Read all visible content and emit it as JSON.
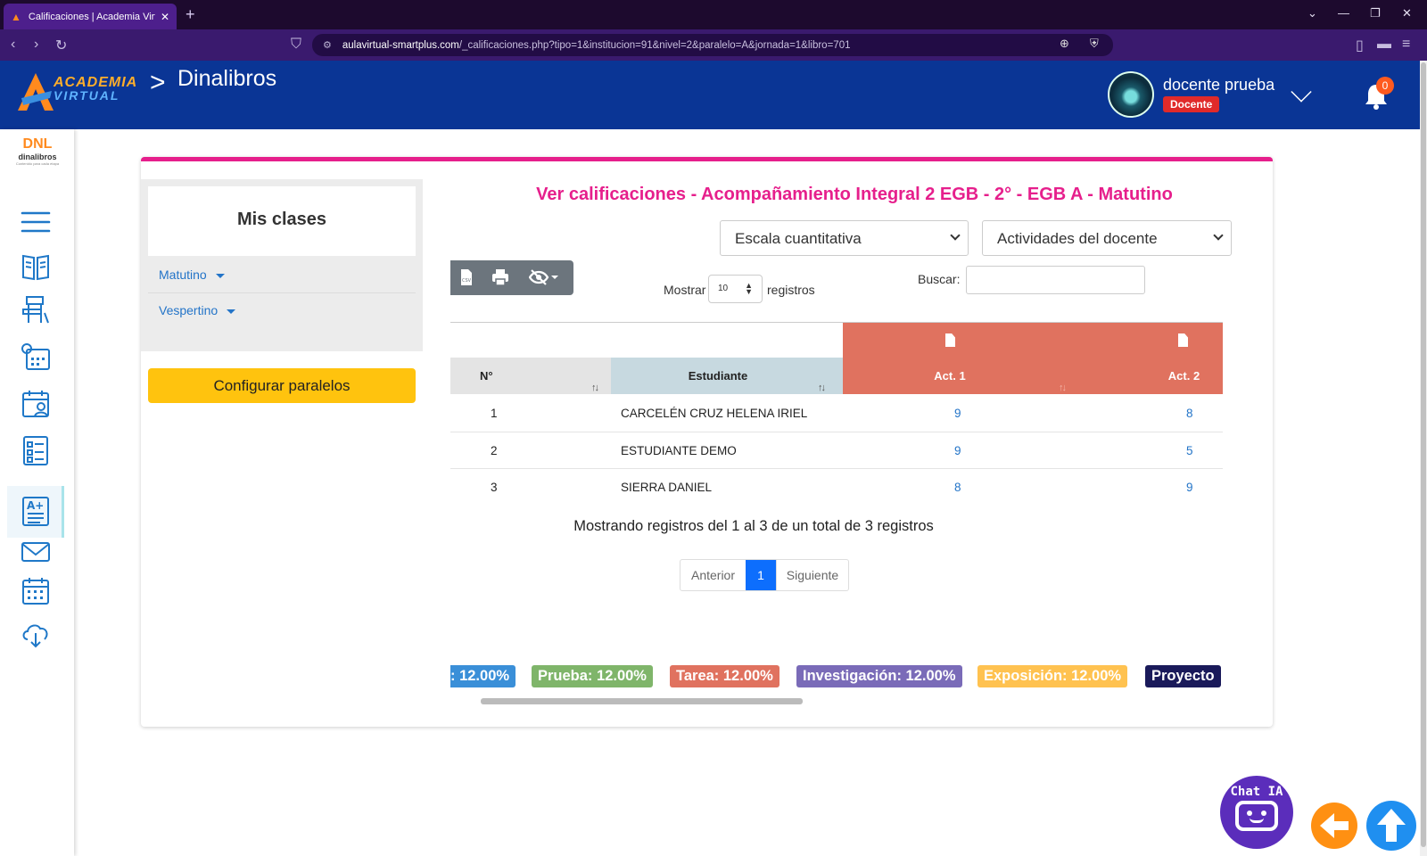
{
  "browser": {
    "tab_title": "Calificaciones | Academia Virtu",
    "url_domain": "aulavirtual-smartplus.com",
    "url_path": "/_calificaciones.php?tipo=1&institucion=91&nivel=2&paralelo=A&jornada=1&libro=701"
  },
  "header": {
    "logo_line1": "ACADEMIA",
    "logo_line2": "VIRTUAL",
    "section_title": "Dinalibros",
    "user_name": "docente prueba",
    "user_role": "Docente",
    "notifications_count": "0"
  },
  "sidebar": {
    "brand_mark": "DNL",
    "brand_name": "dinalibros",
    "brand_tagline": "Contenido para cada etapa",
    "items": [
      "menu",
      "libros",
      "aula",
      "horario",
      "agenda",
      "tareas",
      "calificaciones",
      "mensajes",
      "calendario",
      "descargas"
    ],
    "active_item": "calificaciones"
  },
  "left_panel": {
    "title": "Mis clases",
    "jornadas": [
      "Matutino",
      "Vespertino"
    ],
    "config_button": "Configurar paralelos"
  },
  "main": {
    "title": "Ver calificaciones - Acompañamiento Integral 2 EGB - 2° - EGB A - Matutino",
    "scale_select": "Escala cuantitativa",
    "activities_select": "Actividades del docente",
    "show_label": "Mostrar",
    "page_length": "10",
    "records_label": "registros",
    "search_label": "Buscar:",
    "search_value": ""
  },
  "table": {
    "columns": [
      "N°",
      "Estudiante",
      "Act. 1",
      "Act. 2"
    ],
    "rows": [
      {
        "n": "1",
        "student": "CARCELÉN CRUZ HELENA IRIEL",
        "act1": "9",
        "act2": "8"
      },
      {
        "n": "2",
        "student": "ESTUDIANTE DEMO",
        "act1": "9",
        "act2": "5"
      },
      {
        "n": "3",
        "student": "SIERRA DANIEL",
        "act1": "8",
        "act2": "9"
      }
    ],
    "info": "Mostrando registros del 1 al 3 de un total de 3 registros",
    "pager": {
      "prev": "Anterior",
      "current": "1",
      "next": "Siguiente"
    }
  },
  "weights": [
    {
      "label": ": 12.00%",
      "color": "#3a8fd8"
    },
    {
      "label": "Prueba: 12.00%",
      "color": "#7fb56a"
    },
    {
      "label": "Tarea: 12.00%",
      "color": "#e0725f"
    },
    {
      "label": "Investigación: 12.00%",
      "color": "#7a6bb8"
    },
    {
      "label": "Exposición: 12.00%",
      "color": "#ffc250"
    },
    {
      "label": "Proyecto",
      "color": "#1a1a5a"
    }
  ],
  "floating": {
    "chat_label": "Chat IA"
  },
  "colors": {
    "brand_blue": "#0a3595",
    "accent_pink": "#e61f8c",
    "button_yellow": "#ffc30e",
    "activity_header": "#e0725f"
  }
}
